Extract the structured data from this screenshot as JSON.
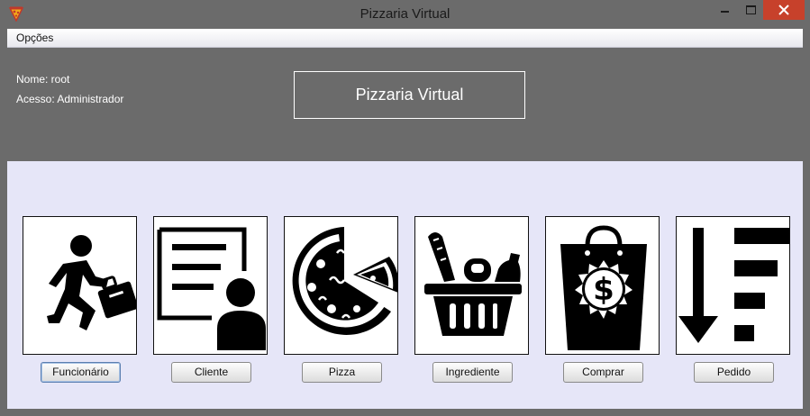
{
  "window": {
    "title": "Pizzaria Virtual",
    "close_color": "#c7412b"
  },
  "menu": {
    "items": [
      {
        "label": "Opções"
      }
    ]
  },
  "header": {
    "user_name": "Nome: root",
    "user_access": "Acesso: Administrador",
    "brand": "Pizzaria Virtual"
  },
  "modules": [
    {
      "label": "Funcionário",
      "icon": "running-worker-icon"
    },
    {
      "label": "Cliente",
      "icon": "client-card-icon"
    },
    {
      "label": "Pizza",
      "icon": "pizza-icon"
    },
    {
      "label": "Ingrediente",
      "icon": "grocery-basket-icon"
    },
    {
      "label": "Comprar",
      "icon": "money-bag-icon"
    },
    {
      "label": "Pedido",
      "icon": "sort-descending-icon"
    }
  ],
  "colors": {
    "background": "#e6e6f8",
    "header": "#6b6b6b"
  }
}
